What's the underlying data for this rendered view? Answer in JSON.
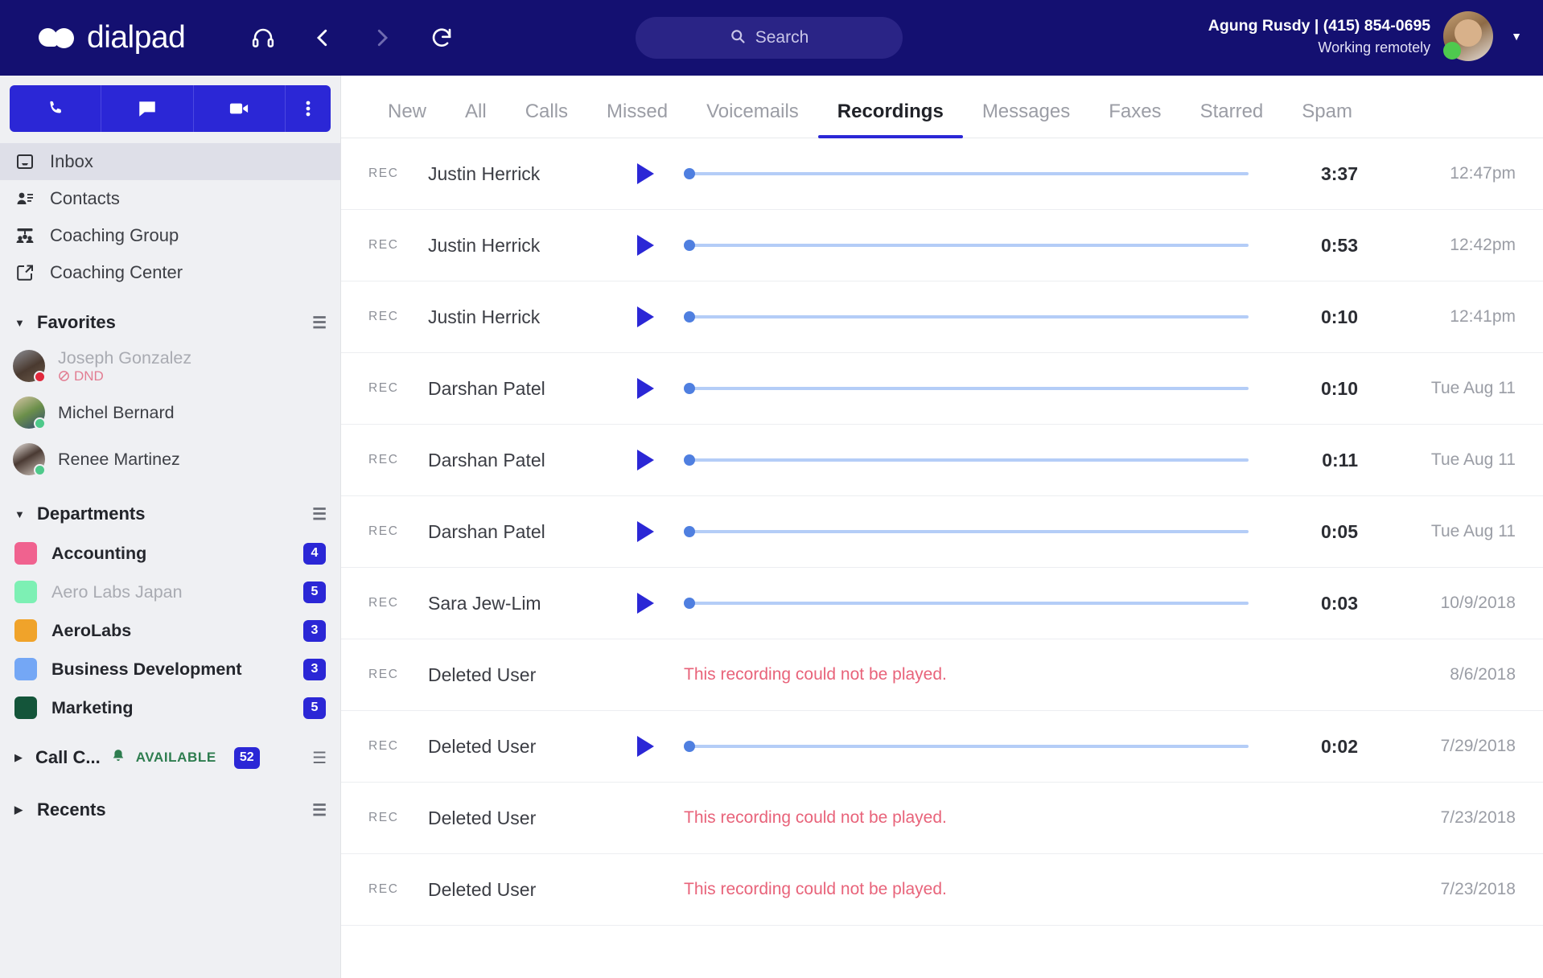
{
  "app": {
    "brand": "dialpad",
    "accent": "#2b27d6",
    "topbar_bg": "#141071"
  },
  "topbar": {
    "icons": [
      {
        "name": "headset-icon",
        "glyph": "headset"
      },
      {
        "name": "back-arrow-icon",
        "glyph": "chevron-left"
      },
      {
        "name": "forward-arrow-icon",
        "glyph": "chevron-right"
      },
      {
        "name": "refresh-icon",
        "glyph": "refresh"
      }
    ],
    "search_placeholder": "Search",
    "user": {
      "name_and_number": "Agung Rusdy | (415) 854-0695",
      "status": "Working remotely",
      "presence_color": "#4ec94e"
    }
  },
  "sidebar": {
    "actions": [
      {
        "name": "call-action",
        "glyph": "phone"
      },
      {
        "name": "message-action",
        "glyph": "chat"
      },
      {
        "name": "video-action",
        "glyph": "video"
      },
      {
        "name": "more-action",
        "glyph": "kebab"
      }
    ],
    "nav": [
      {
        "label": "Inbox",
        "icon": "inbox-icon",
        "active": true
      },
      {
        "label": "Contacts",
        "icon": "contacts-icon",
        "active": false
      },
      {
        "label": "Coaching Group",
        "icon": "coaching-group-icon",
        "active": false
      },
      {
        "label": "Coaching Center",
        "icon": "coaching-center-icon",
        "active": false
      }
    ],
    "favorites": {
      "title": "Favorites",
      "items": [
        {
          "name": "Joseph Gonzalez",
          "status": "DND",
          "presence_color": "#e0283c",
          "muted": true
        },
        {
          "name": "Michel Bernard",
          "status": "",
          "presence_color": "#4ec98a",
          "muted": false
        },
        {
          "name": "Renee Martinez",
          "status": "",
          "presence_color": "#4ec98a",
          "muted": false
        }
      ]
    },
    "departments": {
      "title": "Departments",
      "items": [
        {
          "name": "Accounting",
          "color": "#f0628f",
          "badge": "4",
          "muted": false
        },
        {
          "name": "Aero Labs Japan",
          "color": "#7df0b4",
          "badge": "5",
          "muted": true
        },
        {
          "name": "AeroLabs",
          "color": "#f0a32a",
          "badge": "3",
          "muted": false
        },
        {
          "name": "Business Development",
          "color": "#74a7f5",
          "badge": "3",
          "muted": false
        },
        {
          "name": "Marketing",
          "color": "#14553a",
          "badge": "5",
          "muted": false
        }
      ]
    },
    "call_center": {
      "label": "Call C...",
      "availability": "AVAILABLE",
      "badge": "52"
    },
    "recents": {
      "label": "Recents"
    }
  },
  "main": {
    "tabs": [
      {
        "label": "New",
        "active": false
      },
      {
        "label": "All",
        "active": false
      },
      {
        "label": "Calls",
        "active": false
      },
      {
        "label": "Missed",
        "active": false
      },
      {
        "label": "Voicemails",
        "active": false
      },
      {
        "label": "Recordings",
        "active": true
      },
      {
        "label": "Messages",
        "active": false
      },
      {
        "label": "Faxes",
        "active": false
      },
      {
        "label": "Starred",
        "active": false
      },
      {
        "label": "Spam",
        "active": false
      }
    ],
    "row_tag": "REC",
    "error_text": "This recording could not be played.",
    "recordings": [
      {
        "tag": "REC",
        "name": "Justin Herrick",
        "playable": true,
        "duration": "3:37",
        "timestamp": "12:47pm"
      },
      {
        "tag": "REC",
        "name": "Justin Herrick",
        "playable": true,
        "duration": "0:53",
        "timestamp": "12:42pm"
      },
      {
        "tag": "REC",
        "name": "Justin Herrick",
        "playable": true,
        "duration": "0:10",
        "timestamp": "12:41pm"
      },
      {
        "tag": "REC",
        "name": "Darshan Patel",
        "playable": true,
        "duration": "0:10",
        "timestamp": "Tue Aug 11"
      },
      {
        "tag": "REC",
        "name": "Darshan Patel",
        "playable": true,
        "duration": "0:11",
        "timestamp": "Tue Aug 11"
      },
      {
        "tag": "REC",
        "name": "Darshan Patel",
        "playable": true,
        "duration": "0:05",
        "timestamp": "Tue Aug 11"
      },
      {
        "tag": "REC",
        "name": "Sara Jew-Lim",
        "playable": true,
        "duration": "0:03",
        "timestamp": "10/9/2018"
      },
      {
        "tag": "REC",
        "name": "Deleted User",
        "playable": false,
        "duration": "",
        "timestamp": "8/6/2018"
      },
      {
        "tag": "REC",
        "name": "Deleted User",
        "playable": true,
        "duration": "0:02",
        "timestamp": "7/29/2018"
      },
      {
        "tag": "REC",
        "name": "Deleted User",
        "playable": false,
        "duration": "",
        "timestamp": "7/23/2018"
      },
      {
        "tag": "REC",
        "name": "Deleted User",
        "playable": false,
        "duration": "",
        "timestamp": "7/23/2018"
      }
    ]
  }
}
